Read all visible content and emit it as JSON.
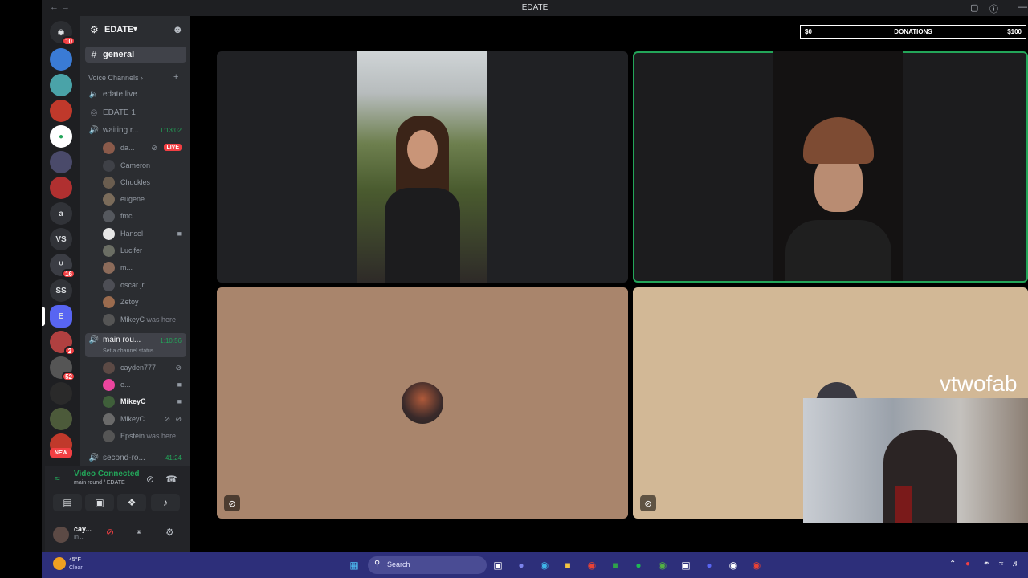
{
  "window": {
    "title": "EDATE"
  },
  "server": {
    "name": "EDATE"
  },
  "donation": {
    "min": "$0",
    "label": "DONATIONS",
    "max": "$100",
    "progress": 0
  },
  "channels": {
    "general": "general",
    "voice_category": "Voice Channels",
    "edate_live": "edate live",
    "edate_1": "EDATE 1",
    "waiting_room": "waiting r...",
    "waiting_room_time": "1:13:02",
    "main_round": "main rou...",
    "main_round_time": "1:10:56",
    "main_round_status": "Set a channel status",
    "second_round": "second-ro...",
    "second_round_time": "41:24"
  },
  "waiting_members": [
    {
      "name": "da...",
      "live": "LIVE",
      "color": "#8a5a4a"
    },
    {
      "name": "Cameron",
      "color": "#3f4147"
    },
    {
      "name": "Chuckles",
      "color": "#6a5d4f"
    },
    {
      "name": "eugene",
      "color": "#7a6b5a"
    },
    {
      "name": "fmc",
      "color": "#55585e"
    },
    {
      "name": "Hansel",
      "color": "#e6e6e6"
    },
    {
      "name": "Lucifer",
      "color": "#6b6e64"
    },
    {
      "name": "m...",
      "color": "#8c6b5a"
    },
    {
      "name": "oscar jr",
      "color": "#4d4e55"
    },
    {
      "name": "Zetoy",
      "color": "#9b6b4e"
    },
    {
      "name": "MikeyC",
      "suffix": "was here",
      "color": "#555"
    }
  ],
  "main_members": [
    {
      "name": "cayden777",
      "color": "#5c4a45"
    },
    {
      "name": "e...",
      "color": "#eb459e"
    },
    {
      "name": "MikeyC",
      "color": "#3f5f3a"
    },
    {
      "name": "MikeyC",
      "color": "#6a6a6a"
    },
    {
      "name": "Epstein",
      "suffix": "was here",
      "color": "#555"
    }
  ],
  "voice_panel": {
    "status": "Video Connected",
    "sub": "main round / EDATE"
  },
  "user": {
    "name": "cay...",
    "status": "In ..."
  },
  "rail": {
    "new_label": "NEW",
    "servers": [
      "a",
      "VS",
      "SS",
      "E"
    ],
    "badges": [
      "10",
      "16",
      "2",
      "52"
    ]
  },
  "stream": {
    "overlay_name": "vtwofab"
  },
  "taskbar": {
    "search": "Search",
    "weather_temp": "45°F",
    "weather_cond": "Clear"
  },
  "colors": {
    "accent_green": "#23a559",
    "danger": "#f23f43",
    "taskbar": "#2d2f7a"
  }
}
